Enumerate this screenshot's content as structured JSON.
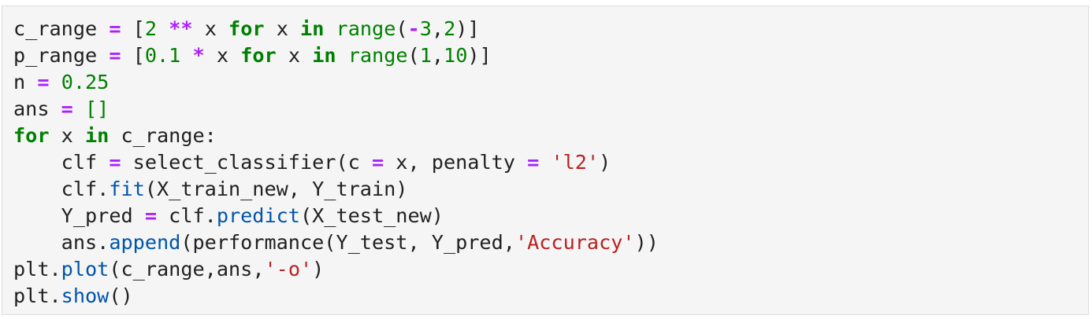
{
  "cell": {
    "colors": {
      "background": "#f5f5f5",
      "text": "#212121",
      "keyword": "#008000",
      "operator": "#aa22ff",
      "number": "#008000",
      "string": "#ba2121",
      "method": "#0055aa"
    },
    "lines": [
      {
        "name": "line-c-range",
        "tokens": [
          {
            "t": "c_range ",
            "c": "text"
          },
          {
            "t": "=",
            "c": "operator"
          },
          {
            "t": " [",
            "c": "text"
          },
          {
            "t": "2",
            "c": "number"
          },
          {
            "t": " ",
            "c": "text"
          },
          {
            "t": "**",
            "c": "operator"
          },
          {
            "t": " x ",
            "c": "text"
          },
          {
            "t": "for",
            "c": "keyword"
          },
          {
            "t": " x ",
            "c": "text"
          },
          {
            "t": "in",
            "c": "keyword"
          },
          {
            "t": " ",
            "c": "text"
          },
          {
            "t": "range",
            "c": "keyword-fn"
          },
          {
            "t": "(",
            "c": "text"
          },
          {
            "t": "-",
            "c": "operator"
          },
          {
            "t": "3",
            "c": "number"
          },
          {
            "t": ",",
            "c": "text"
          },
          {
            "t": "2",
            "c": "number"
          },
          {
            "t": ")]",
            "c": "text"
          }
        ]
      },
      {
        "name": "line-p-range",
        "tokens": [
          {
            "t": "p_range ",
            "c": "text"
          },
          {
            "t": "=",
            "c": "operator"
          },
          {
            "t": " [",
            "c": "text"
          },
          {
            "t": "0.1",
            "c": "number"
          },
          {
            "t": " ",
            "c": "text"
          },
          {
            "t": "*",
            "c": "operator"
          },
          {
            "t": " x ",
            "c": "text"
          },
          {
            "t": "for",
            "c": "keyword"
          },
          {
            "t": " x ",
            "c": "text"
          },
          {
            "t": "in",
            "c": "keyword"
          },
          {
            "t": " ",
            "c": "text"
          },
          {
            "t": "range",
            "c": "keyword-fn"
          },
          {
            "t": "(",
            "c": "text"
          },
          {
            "t": "1",
            "c": "number"
          },
          {
            "t": ",",
            "c": "text"
          },
          {
            "t": "10",
            "c": "number"
          },
          {
            "t": ")]",
            "c": "text"
          }
        ]
      },
      {
        "name": "line-n",
        "tokens": [
          {
            "t": "n ",
            "c": "text"
          },
          {
            "t": "=",
            "c": "operator"
          },
          {
            "t": " ",
            "c": "text"
          },
          {
            "t": "0.25",
            "c": "number"
          }
        ]
      },
      {
        "name": "line-ans",
        "tokens": [
          {
            "t": "ans ",
            "c": "text"
          },
          {
            "t": "=",
            "c": "operator"
          },
          {
            "t": " ",
            "c": "text"
          },
          {
            "t": "[]",
            "c": "number"
          }
        ]
      },
      {
        "name": "line-for-loop",
        "tokens": [
          {
            "t": "for",
            "c": "keyword"
          },
          {
            "t": " x ",
            "c": "text"
          },
          {
            "t": "in",
            "c": "keyword"
          },
          {
            "t": " c_range:",
            "c": "text"
          }
        ]
      },
      {
        "name": "line-clf-assign",
        "tokens": [
          {
            "t": "    clf ",
            "c": "text"
          },
          {
            "t": "=",
            "c": "operator"
          },
          {
            "t": " select_classifier(c ",
            "c": "text"
          },
          {
            "t": "=",
            "c": "operator"
          },
          {
            "t": " x, penalty ",
            "c": "text"
          },
          {
            "t": "=",
            "c": "operator"
          },
          {
            "t": " ",
            "c": "text"
          },
          {
            "t": "'l2'",
            "c": "string"
          },
          {
            "t": ")",
            "c": "text"
          }
        ]
      },
      {
        "name": "line-clf-fit",
        "tokens": [
          {
            "t": "    clf.",
            "c": "text"
          },
          {
            "t": "fit",
            "c": "method"
          },
          {
            "t": "(X_train_new, Y_train)",
            "c": "text"
          }
        ]
      },
      {
        "name": "line-y-pred",
        "tokens": [
          {
            "t": "    Y_pred ",
            "c": "text"
          },
          {
            "t": "=",
            "c": "operator"
          },
          {
            "t": " clf.",
            "c": "text"
          },
          {
            "t": "predict",
            "c": "method"
          },
          {
            "t": "(X_test_new)",
            "c": "text"
          }
        ]
      },
      {
        "name": "line-ans-append",
        "tokens": [
          {
            "t": "    ans.",
            "c": "text"
          },
          {
            "t": "append",
            "c": "method"
          },
          {
            "t": "(performance(Y_test, Y_pred,",
            "c": "text"
          },
          {
            "t": "'Accuracy'",
            "c": "string"
          },
          {
            "t": "))",
            "c": "text"
          }
        ]
      },
      {
        "name": "line-plt-plot",
        "tokens": [
          {
            "t": "plt.",
            "c": "text"
          },
          {
            "t": "plot",
            "c": "method"
          },
          {
            "t": "(c_range,ans,",
            "c": "text"
          },
          {
            "t": "'-o'",
            "c": "string"
          },
          {
            "t": ")",
            "c": "text"
          }
        ]
      },
      {
        "name": "line-plt-show",
        "tokens": [
          {
            "t": "plt.",
            "c": "text"
          },
          {
            "t": "show",
            "c": "method"
          },
          {
            "t": "()",
            "c": "text"
          }
        ]
      }
    ]
  }
}
